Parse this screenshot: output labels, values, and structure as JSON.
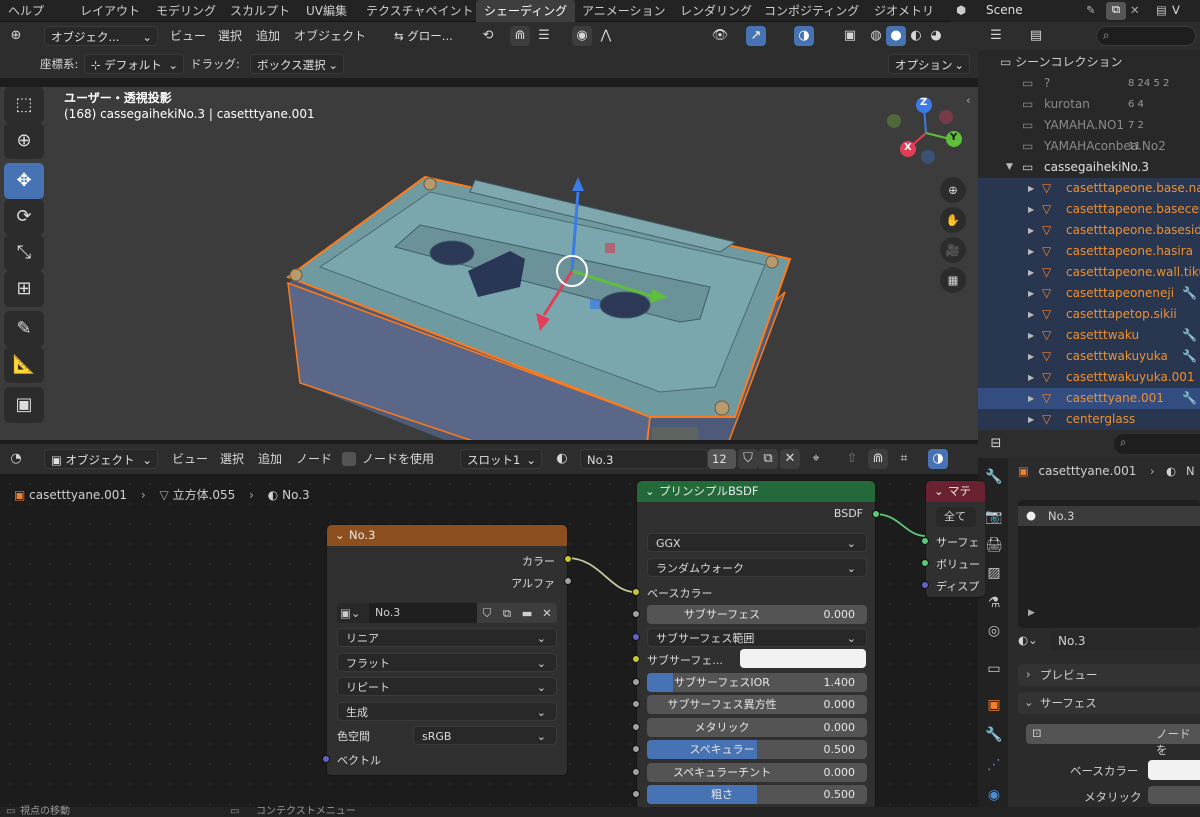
{
  "topbar": {
    "help_menu": "ヘルプ",
    "tabs": [
      "レイアウト",
      "モデリング",
      "スカルプト",
      "UV編集",
      "テクスチャペイント",
      "シェーディング",
      "アニメーション",
      "レンダリング",
      "コンポジティング",
      "ジオメトリ"
    ],
    "active_tab": "シェーディング",
    "scene_label": "Scene",
    "view_layer_label": "V"
  },
  "viewport": {
    "mode": "オブジェク...",
    "menus": [
      "ビュー",
      "選択",
      "追加",
      "オブジェクト"
    ],
    "transform_orientation": "グロー...",
    "coord_label": "座標系:",
    "coord_value": "デフォルト",
    "drag_label": "ドラッグ:",
    "drag_value": "ボックス選択",
    "options_label": "オプション",
    "view_name": "ユーザー・透視投影",
    "object_info": "(168) cassegaihekiNo.3 | casetttyane.001",
    "gizmo_x": "X",
    "gizmo_y": "Y",
    "gizmo_z": "Z"
  },
  "outliner": {
    "search_placeholder": "",
    "root": "シーンコレクション",
    "items": [
      {
        "name": "?",
        "extra": "8  24  5  2"
      },
      {
        "name": "kurotan",
        "extra": "6  4"
      },
      {
        "name": "YAMAHA.NO1",
        "extra": "7  2"
      },
      {
        "name": "YAMAHAconbea.No2",
        "extra": "11"
      },
      {
        "name": "cassegaihekiNo.3",
        "extra": ""
      },
      {
        "name": "casetttapeone.base.naka"
      },
      {
        "name": "casetttapeone.basecenter"
      },
      {
        "name": "casetttapeone.baseside"
      },
      {
        "name": "casetttapeone.hasira"
      },
      {
        "name": "casetttapeone.wall.tikuwa"
      },
      {
        "name": "casetttapeoneneji"
      },
      {
        "name": "casetttapetop.sikii"
      },
      {
        "name": "casetttwaku"
      },
      {
        "name": "casetttwakuyuka"
      },
      {
        "name": "casetttwakuyuka.001"
      },
      {
        "name": "casetttyane.001"
      },
      {
        "name": "centerglass"
      }
    ]
  },
  "node_editor": {
    "mode": "オブジェクト",
    "menus": [
      "ビュー",
      "選択",
      "追加",
      "ノード"
    ],
    "use_nodes_label": "ノードを使用",
    "slot": "スロット1",
    "material": "No.3",
    "users": "12",
    "breadcrumb": [
      "casetttyane.001",
      "立方体.055",
      "No.3"
    ],
    "image_node": {
      "title": "No.3",
      "out_color": "カラー",
      "out_alpha": "アルファ",
      "image_name": "No.3",
      "interpolation": "リニア",
      "projection": "フラット",
      "extension": "リピート",
      "source": "生成",
      "colorspace_label": "色空間",
      "colorspace_value": "sRGB",
      "in_vector": "ベクトル"
    },
    "bsdf_node": {
      "title": "プリンシプルBSDF",
      "out_bsdf": "BSDF",
      "distribution": "GGX",
      "subsurface_method": "ランダムウォーク",
      "base_color": "ベースカラー",
      "subsurface_label": "サブサーフェス",
      "subsurface_value": "0.000",
      "subsurface_radius": "サブサーフェス範囲",
      "subsurface_color": "サブサーフェ...",
      "subsurface_ior_label": "サブサーフェスIOR",
      "subsurface_ior_value": "1.400",
      "subsurface_ior_fill": 0.12,
      "subsurface_aniso_label": "サブサーフェス異方性",
      "subsurface_aniso_value": "0.000",
      "metallic_label": "メタリック",
      "metallic_value": "0.000",
      "specular_label": "スペキュラー",
      "specular_value": "0.500",
      "specular_fill": 0.5,
      "specular_tint_label": "スペキュラーチント",
      "specular_tint_value": "0.000",
      "roughness_label": "粗さ",
      "roughness_value": "0.500",
      "roughness_fill": 0.5
    },
    "output_node": {
      "title": "マテ",
      "target": "全て",
      "in_surface": "サーフェ",
      "in_volume": "ボリュー",
      "in_displacement": "ディスプ"
    }
  },
  "properties": {
    "object_name": "casetttyane.001",
    "slot_material": "No.3",
    "material_field": "No.3",
    "preview_label": "プレビュー",
    "surface_label": "サーフェス",
    "node_label": "ノードを",
    "base_color_label": "ベースカラー",
    "metallic_label": "メタリック"
  },
  "statusbar": {
    "left": "視点の移動",
    "middle": "コンテクストメニュー"
  },
  "colors": {
    "accent": "#4772b3",
    "selection": "#f0802d",
    "texture_header": "#8c4f1d",
    "shader_header": "#23693a",
    "output_header": "#6b2230"
  }
}
